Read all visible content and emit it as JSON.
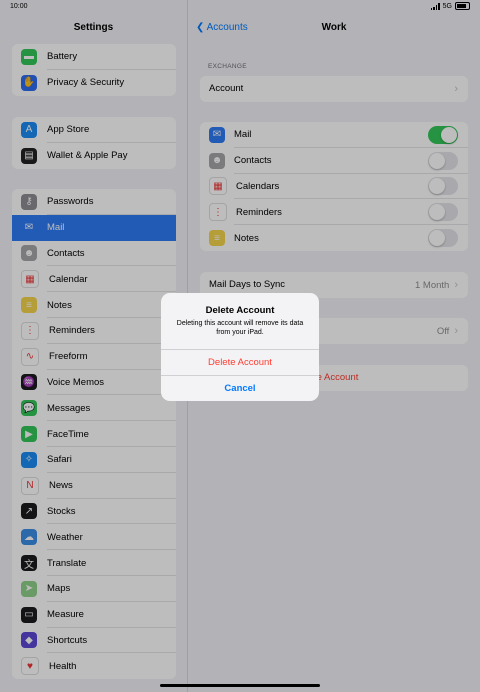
{
  "status": {
    "time": "10:00",
    "network": "5G"
  },
  "sidebar": {
    "title": "Settings",
    "group1": [
      {
        "label": "Battery",
        "color": "#34c759",
        "glyph": "▬",
        "name": "battery"
      },
      {
        "label": "Privacy & Security",
        "color": "#2f6bf0",
        "glyph": "✋",
        "name": "privacy-security"
      }
    ],
    "group2": [
      {
        "label": "App Store",
        "color": "#1b8cf3",
        "glyph": "A",
        "name": "app-store"
      },
      {
        "label": "Wallet & Apple Pay",
        "color": "#222222",
        "glyph": "▤",
        "name": "wallet"
      }
    ],
    "group3": [
      {
        "label": "Passwords",
        "color": "#8e8e93",
        "glyph": "⚷",
        "name": "passwords"
      },
      {
        "label": "Mail",
        "color": "#2f7bf6",
        "glyph": "✉",
        "name": "mail",
        "selected": true
      },
      {
        "label": "Contacts",
        "color": "#a7a7ab",
        "glyph": "☻",
        "name": "contacts"
      },
      {
        "label": "Calendar",
        "color": "#ffffff",
        "glyph": "▦",
        "name": "calendar"
      },
      {
        "label": "Notes",
        "color": "#f5d44b",
        "glyph": "≡",
        "name": "notes"
      },
      {
        "label": "Reminders",
        "color": "#ffffff",
        "glyph": "⋮",
        "name": "reminders"
      },
      {
        "label": "Freeform",
        "color": "#ffffff",
        "glyph": "∿",
        "name": "freeform"
      },
      {
        "label": "Voice Memos",
        "color": "#1c1c1e",
        "glyph": "♒",
        "name": "voice-memos"
      },
      {
        "label": "Messages",
        "color": "#34c759",
        "glyph": "💬",
        "name": "messages"
      },
      {
        "label": "FaceTime",
        "color": "#34c759",
        "glyph": "▶",
        "name": "facetime"
      },
      {
        "label": "Safari",
        "color": "#1b8cf3",
        "glyph": "✧",
        "name": "safari"
      },
      {
        "label": "News",
        "color": "#ffffff",
        "glyph": "N",
        "name": "news"
      },
      {
        "label": "Stocks",
        "color": "#1c1c1e",
        "glyph": "↗",
        "name": "stocks"
      },
      {
        "label": "Weather",
        "color": "#3a8ee6",
        "glyph": "☁",
        "name": "weather"
      },
      {
        "label": "Translate",
        "color": "#1c1c1e",
        "glyph": "文",
        "name": "translate"
      },
      {
        "label": "Maps",
        "color": "#8fd18a",
        "glyph": "➤",
        "name": "maps"
      },
      {
        "label": "Measure",
        "color": "#1c1c1e",
        "glyph": "▭",
        "name": "measure"
      },
      {
        "label": "Shortcuts",
        "color": "#5b47d6",
        "glyph": "◆",
        "name": "shortcuts"
      },
      {
        "label": "Health",
        "color": "#ffffff",
        "glyph": "♥",
        "name": "health"
      }
    ]
  },
  "detail": {
    "back_label": "Accounts",
    "title": "Work",
    "section_caption": "EXCHANGE",
    "account_label": "Account",
    "toggles": [
      {
        "label": "Mail",
        "on": true,
        "color": "#2f7bf6",
        "glyph": "✉",
        "name": "mail"
      },
      {
        "label": "Contacts",
        "on": false,
        "color": "#a7a7ab",
        "glyph": "☻",
        "name": "contacts"
      },
      {
        "label": "Calendars",
        "on": false,
        "color": "#ffffff",
        "glyph": "▦",
        "name": "calendars"
      },
      {
        "label": "Reminders",
        "on": false,
        "color": "#ffffff",
        "glyph": "⋮",
        "name": "reminders"
      },
      {
        "label": "Notes",
        "on": false,
        "color": "#f5d44b",
        "glyph": "≡",
        "name": "notes"
      }
    ],
    "sync_label": "Mail Days to Sync",
    "sync_value": "1 Month",
    "hidden_value": "Off",
    "delete_fragment": "te Account"
  },
  "alert": {
    "title": "Delete Account",
    "message": "Deleting this account will remove its data from your iPad.",
    "destructive_label": "Delete Account",
    "cancel_label": "Cancel"
  },
  "colors": {
    "accent": "#007aff",
    "destructive": "#ff3b30",
    "toggle_on": "#34c759"
  }
}
